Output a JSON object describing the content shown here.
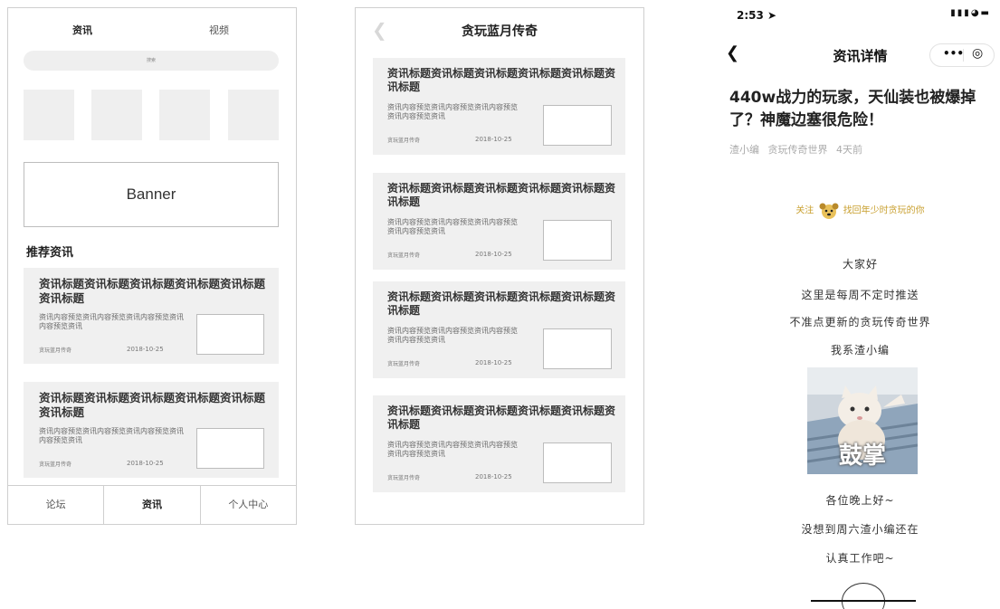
{
  "list_screen": {
    "tabs": [
      "资讯",
      "视频"
    ],
    "search_placeholder": "搜索",
    "banner_label": "Banner",
    "section_title": "推荐资讯",
    "cards": [
      {
        "title": "资讯标题资讯标题资讯标题资讯标题资讯标题资讯标题",
        "desc": "资讯内容预览资讯内容预览资讯内容预览资讯内容预览资讯",
        "source": "贪玩蓝月传奇",
        "date": "2018-10-25"
      },
      {
        "title": "资讯标题资讯标题资讯标题资讯标题资讯标题资讯标题",
        "desc": "资讯内容预览资讯内容预览资讯内容预览资讯内容预览资讯",
        "source": "贪玩蓝月传奇",
        "date": "2018-10-25"
      }
    ],
    "bottom_nav": [
      "论坛",
      "资讯",
      "个人中心"
    ]
  },
  "category_screen": {
    "title": "贪玩蓝月传奇",
    "back_icon": "chevron-left-icon",
    "cards": [
      {
        "title": "资讯标题资讯标题资讯标题资讯标题资讯标题资讯标题",
        "desc": "资讯内容预览资讯内容预览资讯内容预览资讯内容预览资讯",
        "source": "贪玩蓝月传奇",
        "date": "2018-10-25"
      },
      {
        "title": "资讯标题资讯标题资讯标题资讯标题资讯标题资讯标题",
        "desc": "资讯内容预览资讯内容预览资讯内容预览资讯内容预览资讯",
        "source": "贪玩蓝月传奇",
        "date": "2018-10-25"
      },
      {
        "title": "资讯标题资讯标题资讯标题资讯标题资讯标题资讯标题",
        "desc": "资讯内容预览资讯内容预览资讯内容预览资讯内容预览资讯",
        "source": "贪玩蓝月传奇",
        "date": "2018-10-25"
      },
      {
        "title": "资讯标题资讯标题资讯标题资讯标题资讯标题资讯标题",
        "desc": "资讯内容预览资讯内容预览资讯内容预览资讯内容预览资讯",
        "source": "贪玩蓝月传奇",
        "date": "2018-10-25"
      }
    ]
  },
  "detail_screen": {
    "status_time": "2:53",
    "nav_title": "资讯详情",
    "article_title": "440w战力的玩家，天仙装也被爆掉了？神魔边塞很危险！",
    "meta": {
      "author": "渣小编",
      "source": "贪玩传奇世界",
      "time": "4天前"
    },
    "follow_prefix": "关注",
    "follow_text": "找回年少时贪玩的你",
    "lines_top": [
      "大家好",
      "这里是每周不定时推送",
      "不准点更新的贪玩传奇世界",
      "我系渣小编"
    ],
    "image_caption": "鼓掌",
    "lines_bottom": [
      "各位晚上好~",
      "没想到周六渣小编还在",
      "认真工作吧~"
    ],
    "accent_color": "#c9a030"
  }
}
